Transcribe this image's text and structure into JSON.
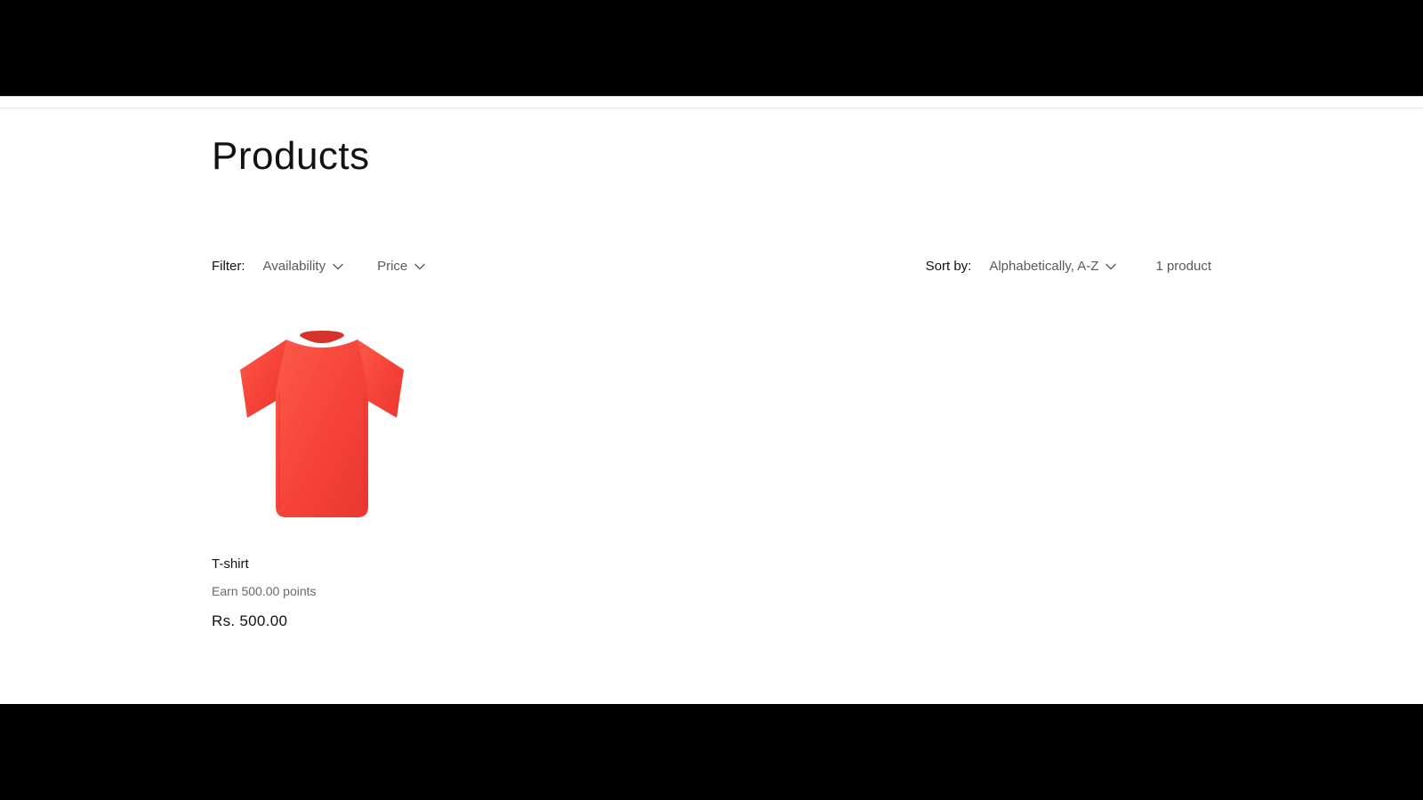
{
  "page": {
    "title": "Products"
  },
  "filters": {
    "label": "Filter:",
    "items": [
      {
        "label": "Availability"
      },
      {
        "label": "Price"
      }
    ]
  },
  "sort": {
    "label": "Sort by:",
    "selected": "Alphabetically, A-Z"
  },
  "count": {
    "text": "1 product"
  },
  "products": [
    {
      "name": "T-shirt",
      "points": "Earn 500.00 points",
      "price": "Rs. 500.00",
      "color": "#f7443a"
    }
  ]
}
